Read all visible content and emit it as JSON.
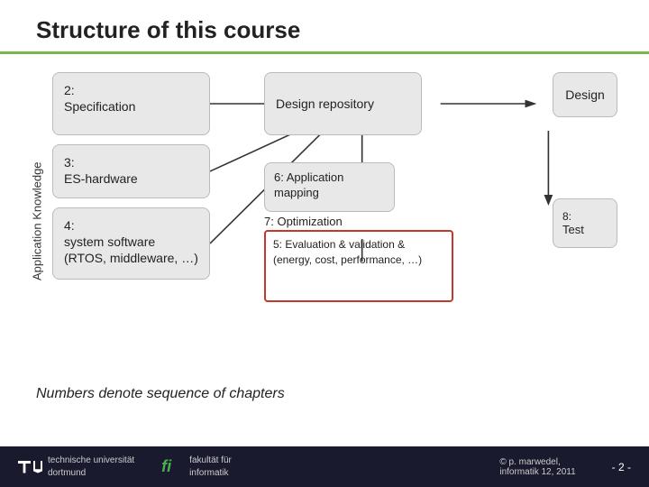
{
  "header": {
    "title": "Structure of this course"
  },
  "diagram": {
    "vertical_label": "Application Knowledge",
    "boxes": {
      "spec": {
        "number": "2:",
        "label": "Specification"
      },
      "es_hardware": {
        "number": "3:",
        "label": "ES-hardware"
      },
      "sys_software": {
        "number": "4:",
        "label": "system software (RTOS, middleware, …)"
      },
      "design_repo": {
        "label": "Design repository"
      },
      "app_mapping": {
        "number": "6:",
        "label": "Application mapping"
      },
      "optimization": {
        "number": "7:",
        "label": "Optimization"
      },
      "evaluation": {
        "number": "5:",
        "label": "Evaluation & validation & (energy, cost, performance, …)"
      },
      "design": {
        "label": "Design"
      },
      "test": {
        "number": "8:",
        "label": "Test"
      }
    }
  },
  "footnote": {
    "text": "Numbers denote sequence of chapters"
  },
  "footer": {
    "university": "technische universität",
    "city": "dortmund",
    "faculty_label": "fakultät für",
    "faculty": "informatik",
    "copyright": "© p. marwedel,",
    "year": "informatik 12,  2011",
    "page": "- 2 -"
  }
}
